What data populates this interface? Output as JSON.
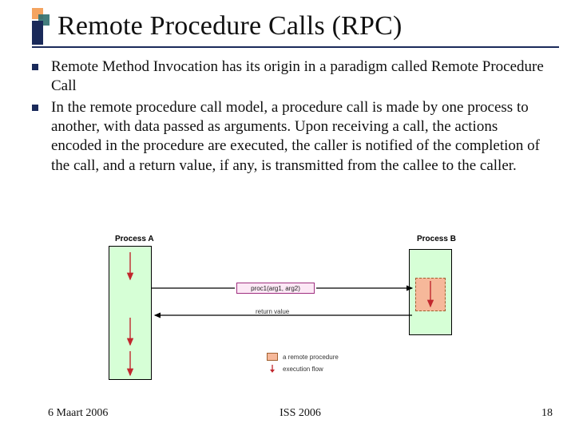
{
  "title": "Remote Procedure Calls (RPC)",
  "bullets": [
    "Remote Method Invocation has its origin in a paradigm called Remote Procedure Call",
    "In the remote procedure call model, a procedure call is made by one process to another, with data passed as arguments.  Upon receiving a call, the actions encoded in the procedure are executed, the caller is notified of the completion of the call, and a return value, if any, is transmitted from the callee to the caller."
  ],
  "diagram": {
    "process_a": "Process A",
    "process_b": "Process B",
    "call_label": "proc1(arg1, arg2)",
    "return_label": "return value",
    "legend_proc": "a remote procedure",
    "legend_flow": "execution flow"
  },
  "footer": {
    "date": "6 Maart 2006",
    "center": "ISS 2006",
    "page": "18"
  }
}
